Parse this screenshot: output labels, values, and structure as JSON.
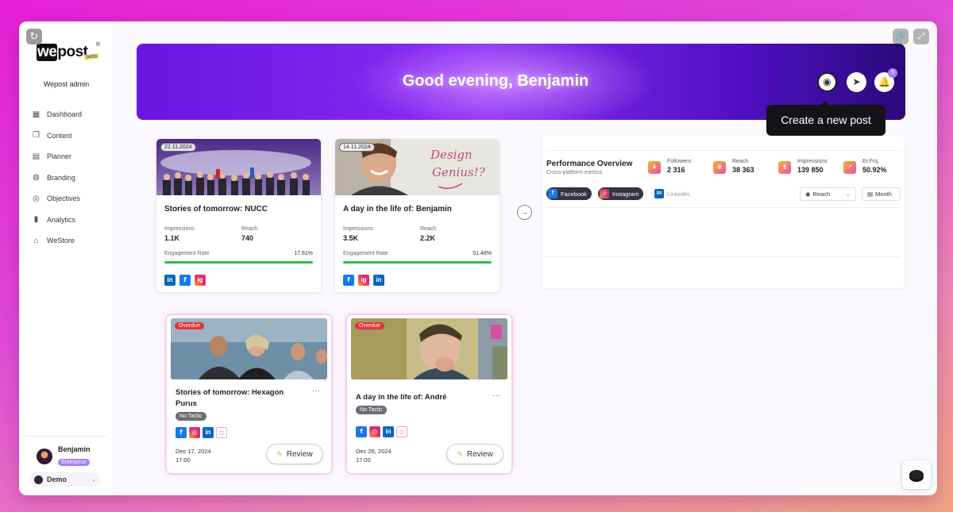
{
  "logo": {
    "word": "we",
    "word2": "post",
    "badge": "beta",
    "reg": "®"
  },
  "workspace_name": "Wepost admin",
  "nav": [
    {
      "label": "Dashboard",
      "icon": "dashboard-icon",
      "glyph": "▦"
    },
    {
      "label": "Content",
      "icon": "content-icon",
      "glyph": "❐"
    },
    {
      "label": "Planner",
      "icon": "calendar-icon",
      "glyph": "▤"
    },
    {
      "label": "Branding",
      "icon": "palette-icon",
      "glyph": "◍"
    },
    {
      "label": "Objectives",
      "icon": "target-icon",
      "glyph": "◎"
    },
    {
      "label": "Analytics",
      "icon": "bar-chart-icon",
      "glyph": "▮"
    },
    {
      "label": "WeStore",
      "icon": "store-icon",
      "glyph": "⌂"
    }
  ],
  "user": {
    "name": "Benjamin",
    "plan": "Enterprise"
  },
  "org_switcher": {
    "label": "Demo"
  },
  "hero": {
    "greeting": "Good evening, Benjamin",
    "notifications": "5"
  },
  "tooltip": "Create a new post",
  "posts": [
    {
      "date": "22.11.2024",
      "title": "Stories of tomorrow: NUCC",
      "impressions_label": "Impressions",
      "impressions": "1.1K",
      "reach_label": "Reach",
      "reach": "740",
      "engagement_label": "Engagement Rate",
      "engagement": "17.61%",
      "engagement_pct": 17.61,
      "socials": [
        "in",
        "f",
        "ig"
      ]
    },
    {
      "date": "14.11.2024",
      "title": "A day in the life of: Benjamin",
      "impressions_label": "Impressions",
      "impressions": "3.5K",
      "reach_label": "Reach",
      "reach": "2.2K",
      "engagement_label": "Engagement Rate",
      "engagement": "51.48%",
      "engagement_pct": 51.48,
      "socials": [
        "f",
        "ig",
        "in"
      ]
    }
  ],
  "performance": {
    "title": "Performance Overview",
    "subtitle": "Cross-platform metrics",
    "kpis": [
      {
        "label": "Followers",
        "value": "2 316"
      },
      {
        "label": "Reach",
        "value": "38 363"
      },
      {
        "label": "Impressions",
        "value": "139 850"
      },
      {
        "label": "Er.Frq.",
        "value": "50.92%"
      }
    ],
    "platforms": [
      {
        "label": "Facebook",
        "active": true
      },
      {
        "label": "Instagram",
        "active": true
      },
      {
        "label": "LinkedIn",
        "active": false
      }
    ],
    "metric_select": "Reach",
    "period_select": "Month"
  },
  "reviews": [
    {
      "badge": "Overdue",
      "title": "Stories of tomorrow: Hexagon Purus",
      "tactic": "No Tactic",
      "date": "Dec 17, 2024",
      "time": "17:00",
      "button": "Review"
    },
    {
      "badge": "Overdue",
      "title": "A day in the life of: André",
      "tactic": "No Tactic",
      "date": "Dec 26, 2024",
      "time": "17:00",
      "button": "Review"
    }
  ],
  "colors": {
    "accent": "#8a2cf5",
    "success": "#2ebd4b",
    "overdue": "#e6333a"
  }
}
